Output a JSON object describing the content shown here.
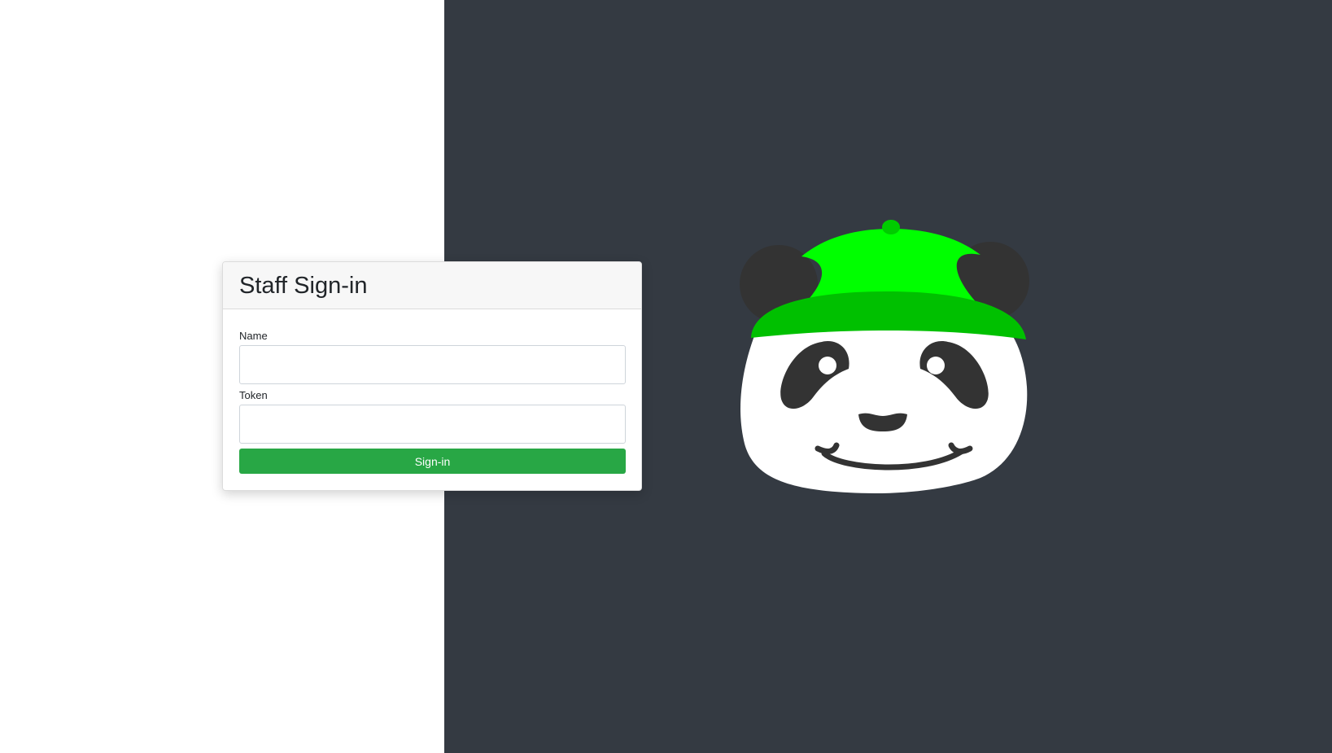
{
  "login": {
    "title": "Staff Sign-in",
    "name_label": "Name",
    "name_value": "",
    "token_label": "Token",
    "token_value": "",
    "submit_label": "Sign-in"
  },
  "colors": {
    "dark_panel": "#343a42",
    "submit_button": "#28a745",
    "hat_top": "#00ff00",
    "hat_brim": "#00c000",
    "panda_dark": "#333333"
  },
  "mascot": {
    "icon": "panda-with-green-cap"
  }
}
